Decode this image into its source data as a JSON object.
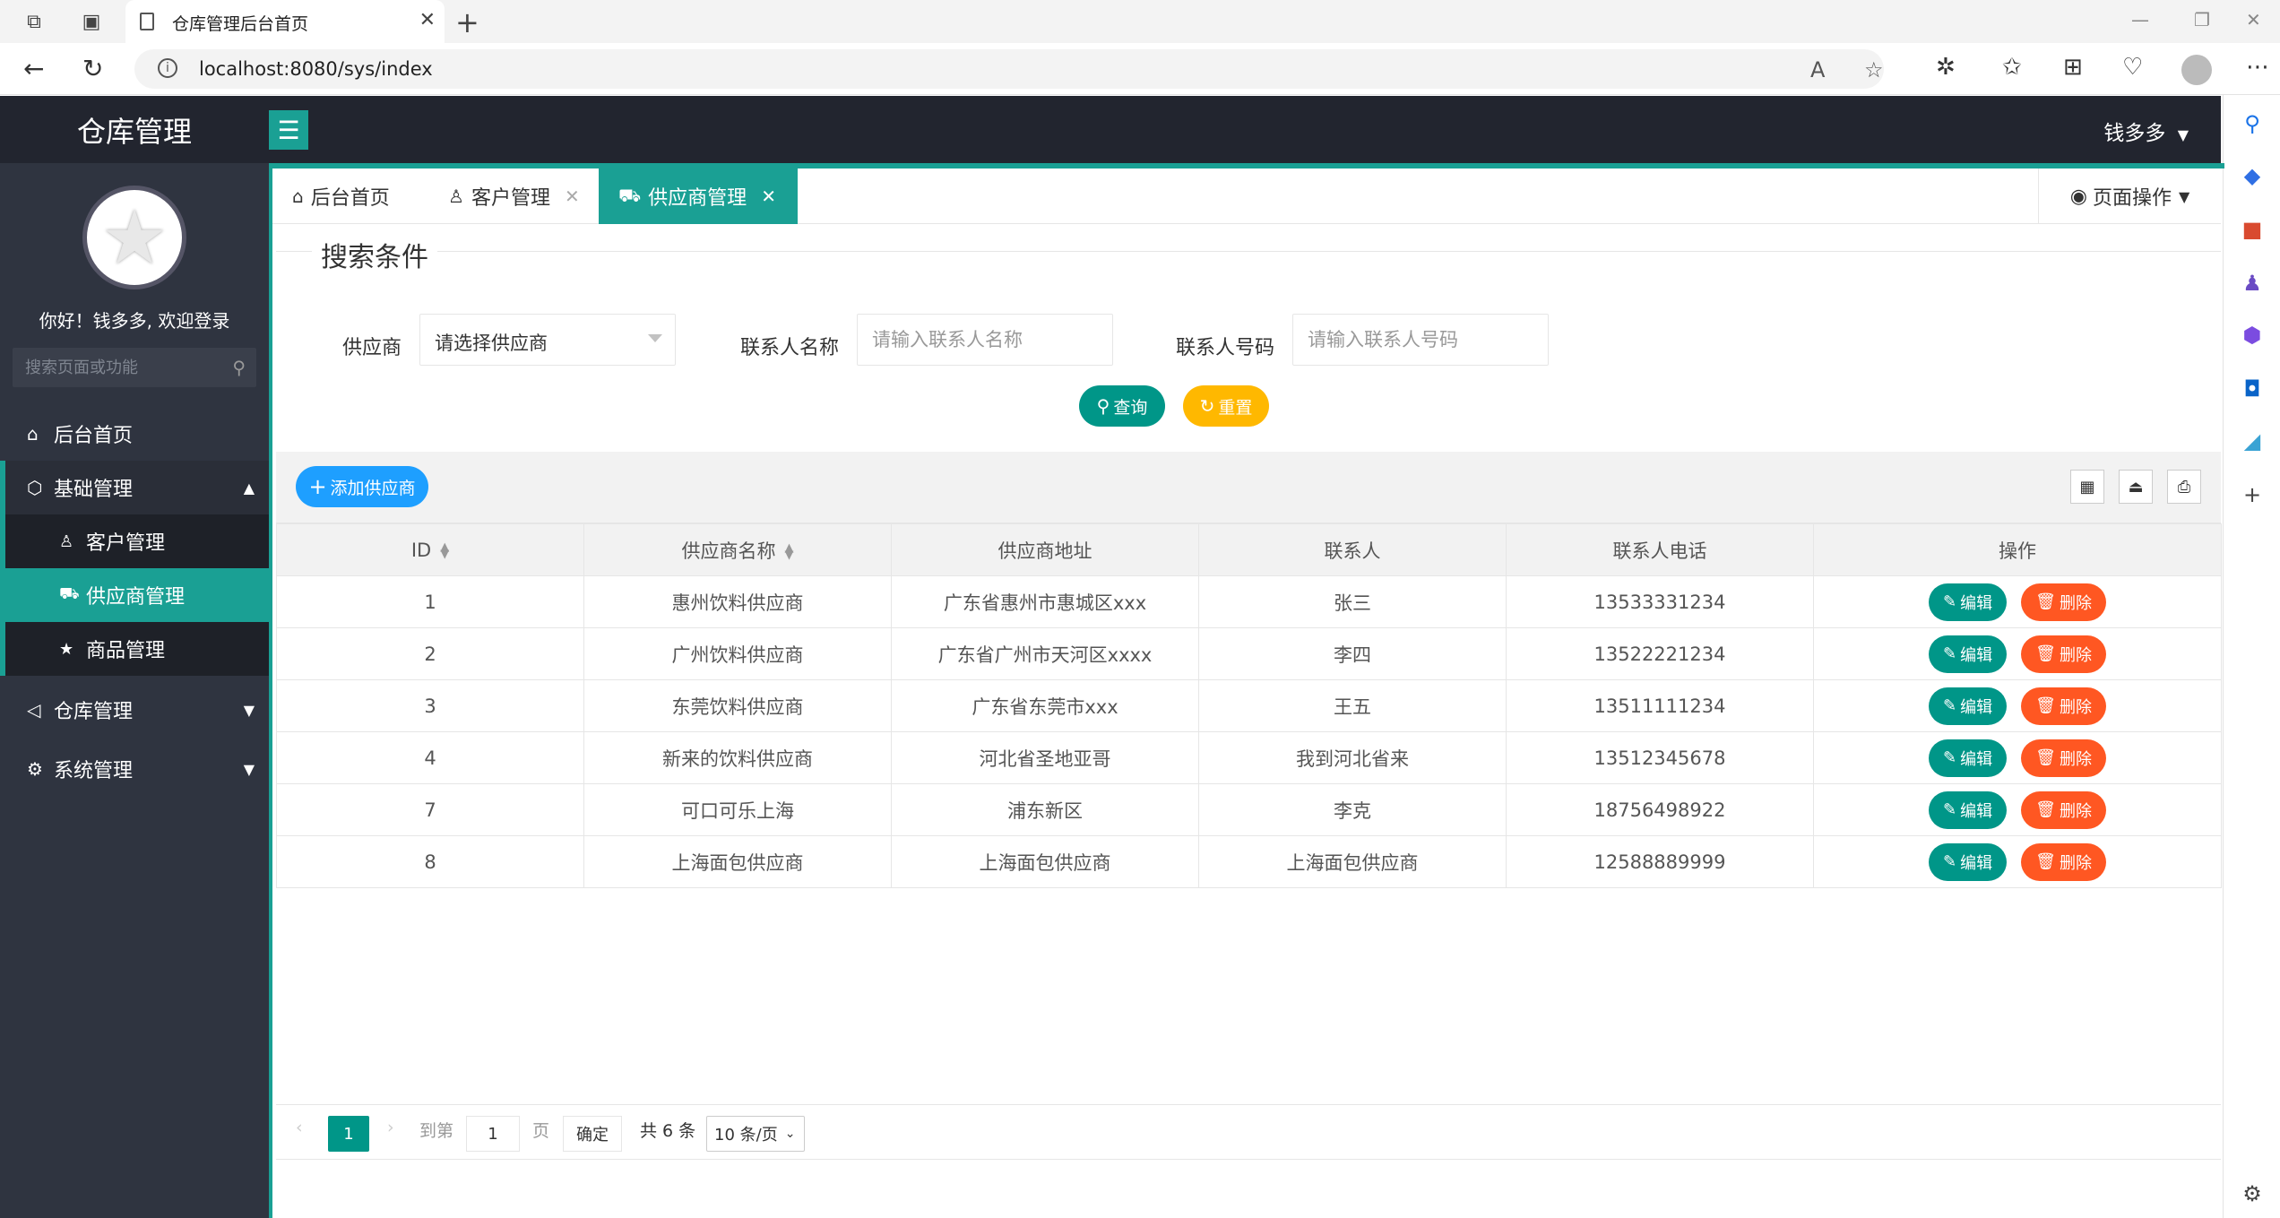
{
  "browser": {
    "tab_title": "仓库管理后台首页",
    "url": "localhost:8080/sys/index"
  },
  "app": {
    "logo": "仓库管理",
    "user_name": "钱多多"
  },
  "sidebar": {
    "welcome": "你好！钱多多, 欢迎登录",
    "search_placeholder": "搜索页面或功能",
    "items": [
      {
        "label": "后台首页"
      },
      {
        "label": "基础管理"
      },
      {
        "label": "仓库管理"
      },
      {
        "label": "系统管理"
      }
    ],
    "sub_items": [
      {
        "label": "客户管理"
      },
      {
        "label": "供应商管理"
      },
      {
        "label": "商品管理"
      }
    ]
  },
  "page_tabs": [
    {
      "label": "后台首页"
    },
    {
      "label": "客户管理"
    },
    {
      "label": "供应商管理"
    }
  ],
  "page_ops": "页面操作",
  "search": {
    "legend": "搜索条件",
    "provider_label": "供应商",
    "provider_value": "请选择供应商",
    "contact_name_label": "联系人名称",
    "contact_name_placeholder": "请输入联系人名称",
    "contact_phone_label": "联系人号码",
    "contact_phone_placeholder": "请输入联系人号码",
    "query_label": "查询",
    "reset_label": "重置"
  },
  "table": {
    "add_label": "添加供应商",
    "headers": [
      "ID",
      "供应商名称",
      "供应商地址",
      "联系人",
      "联系人电话",
      "操作"
    ],
    "edit_label": "编辑",
    "delete_label": "删除",
    "rows": [
      [
        "1",
        "惠州饮料供应商",
        "广东省惠州市惠城区xxx",
        "张三",
        "13533331234"
      ],
      [
        "2",
        "广州饮料供应商",
        "广东省广州市天河区xxxx",
        "李四",
        "13522221234"
      ],
      [
        "3",
        "东莞饮料供应商",
        "广东省东莞市xxx",
        "王五",
        "13511111234"
      ],
      [
        "4",
        "新来的饮料供应商",
        "河北省圣地亚哥",
        "我到河北省来",
        "13512345678"
      ],
      [
        "7",
        "可口可乐上海",
        "浦东新区",
        "李克",
        "18756498922"
      ],
      [
        "8",
        "上海面包供应商",
        "上海面包供应商",
        "上海面包供应商",
        "12588889999"
      ]
    ]
  },
  "pager": {
    "current": "1",
    "goto_label": "到第",
    "goto_value": "1",
    "page_unit": "页",
    "ok_label": "确定",
    "total": "共 6 条",
    "page_size": "10 条/页"
  }
}
